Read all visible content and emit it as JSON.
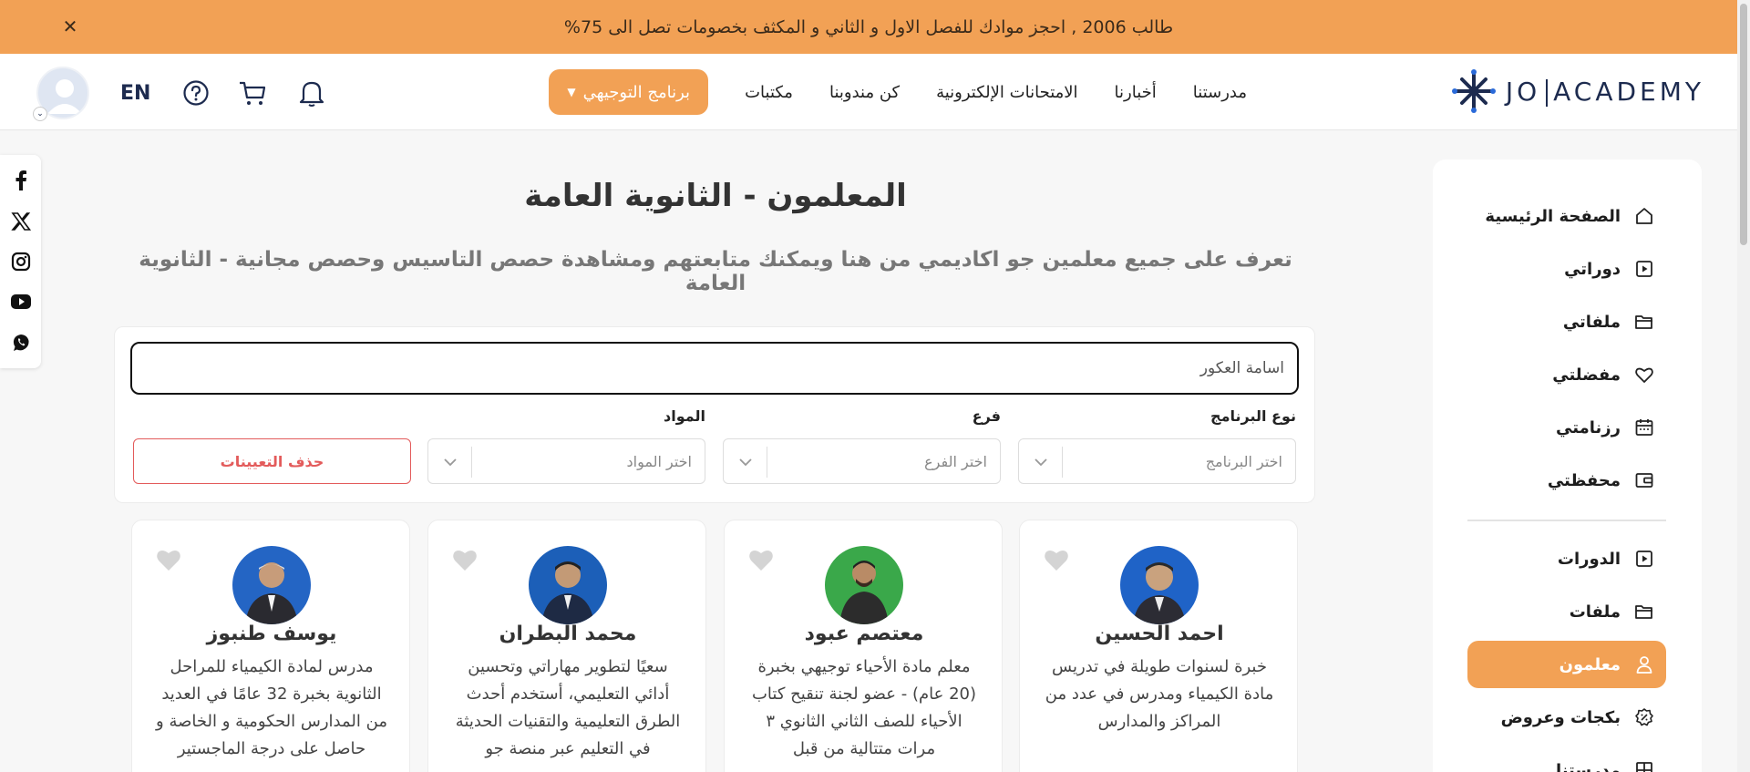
{
  "promo": {
    "text": "طالب 2006 , احجز موادك للفصل الاول و الثاني و المكثف بخصومات تصل الى 75%",
    "close_icon": "✕"
  },
  "logo": {
    "left": "JO",
    "right": "ACADEMY"
  },
  "nav": {
    "items": [
      "مدرستنا",
      "أخبارنا",
      "الامتحانات الإلكترونية",
      "كن مندوبنا",
      "مكتبات"
    ],
    "program_button": "برنامج التوجيهي",
    "lang": "EN"
  },
  "sidebar": {
    "items": [
      {
        "label": "الصفحة الرئيسية",
        "icon": "home-icon"
      },
      {
        "label": "دوراتي",
        "icon": "play-square-icon"
      },
      {
        "label": "ملفاتي",
        "icon": "folder-icon"
      },
      {
        "label": "مفضلتي",
        "icon": "heart-icon"
      },
      {
        "label": "رزنامتي",
        "icon": "calendar-icon"
      },
      {
        "label": "محفظتي",
        "icon": "wallet-icon"
      },
      {
        "label": "الدورات",
        "icon": "play-square-icon"
      },
      {
        "label": "ملفات",
        "icon": "folder-icon"
      },
      {
        "label": "معلمون",
        "icon": "user-icon",
        "active": true
      },
      {
        "label": "بكجات وعروض",
        "icon": "badge-icon"
      },
      {
        "label": "مدرستنا",
        "icon": "grid-icon"
      }
    ]
  },
  "page": {
    "title": "المعلمون - الثانوية العامة",
    "subtitle": "تعرف على جميع معلمين جو اكاديمي من هنا ويمكنك متابعتهم ومشاهدة حصص التاسيس وحصص مجانية - الثانوية العامة"
  },
  "filters": {
    "search_value": "اسامة العكور",
    "program_label": "نوع البرنامج",
    "program_placeholder": "اختر البرنامج",
    "branch_label": "فرع",
    "branch_placeholder": "اختر الفرع",
    "subjects_label": "المواد",
    "subjects_placeholder": "اختر المواد",
    "clear_label": "حذف التعيينات"
  },
  "teachers": [
    {
      "name": "احمد الحسين",
      "desc": "خبرة لسنوات طويلة في تدريس مادة الكيمياء ومدرس في عدد من المراكز والمدارس"
    },
    {
      "name": "معتصم عبود",
      "desc": "معلم مادة الأحياء توجيهي بخبرة (20 عام) - عضو لجنة تنقيح كتاب الأحياء للصف الثاني الثانوي ٣ مرات متتالية من قبل"
    },
    {
      "name": "محمد البطران",
      "desc": "سعيًا لتطوير مهاراتي وتحسين أدائي التعليمي، أستخدم أحدث الطرق التعليمية والتقنيات الحديثة في التعليم عبر منصة جو"
    },
    {
      "name": "يوسف طنبوز",
      "desc": "مدرس لمادة الكيمياء للمراحل الثانوية بخبرة 32 عامًا في العديد من المدارس الحكومية و الخاصة و حاصل على درجة الماجستير"
    }
  ],
  "colors": {
    "accent": "#f2a155",
    "navy": "#1d2b4f",
    "danger": "#e35b5b"
  }
}
